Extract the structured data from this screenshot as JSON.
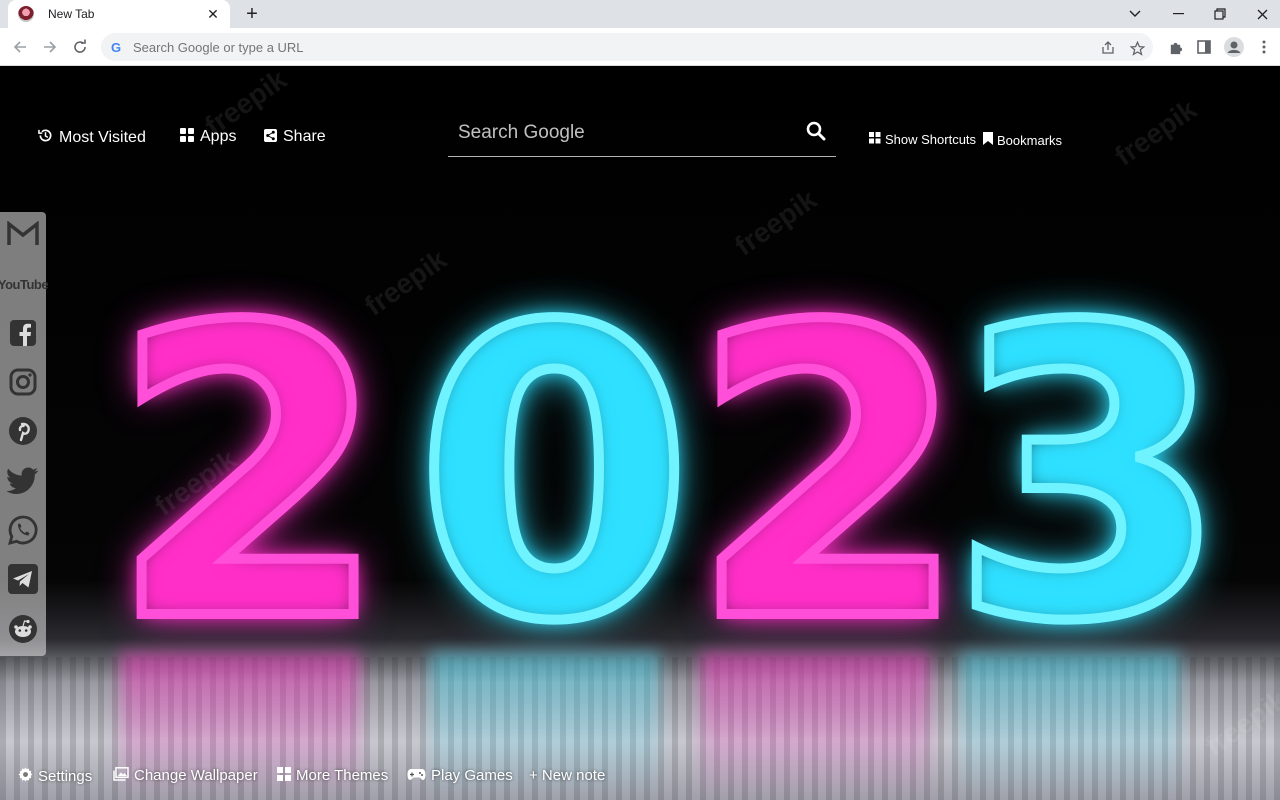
{
  "browser": {
    "tab_title": "New Tab",
    "tab_close": "✕",
    "new_tab": "+",
    "omnibox_placeholder": "Search Google or type a URL"
  },
  "header": {
    "most_visited": "Most Visited",
    "apps": "Apps",
    "share": "Share",
    "search_placeholder": "Search Google",
    "show_shortcuts": "Show Shortcuts",
    "bookmarks": "Bookmarks"
  },
  "wallpaper": {
    "digits": [
      "2",
      "0",
      "2",
      "3"
    ],
    "watermark": "freepik",
    "colors": {
      "pink": "#ff4fd8",
      "cyan": "#6ff3ff"
    }
  },
  "social": {
    "items": [
      {
        "label": "M",
        "icon": "gmail-icon"
      },
      {
        "label": "YouTube",
        "icon": "youtube-icon"
      },
      {
        "label": "f",
        "icon": "facebook-icon"
      },
      {
        "label": "",
        "icon": "instagram-icon"
      },
      {
        "label": "P",
        "icon": "pinterest-icon"
      },
      {
        "label": "",
        "icon": "twitter-icon"
      },
      {
        "label": "",
        "icon": "whatsapp-icon"
      },
      {
        "label": "",
        "icon": "telegram-icon"
      },
      {
        "label": "",
        "icon": "reddit-icon"
      }
    ]
  },
  "footer": {
    "settings": "Settings",
    "change_wallpaper": "Change Wallpaper",
    "more_themes": "More Themes",
    "play_games": "Play Games",
    "new_note": "+ New note"
  }
}
